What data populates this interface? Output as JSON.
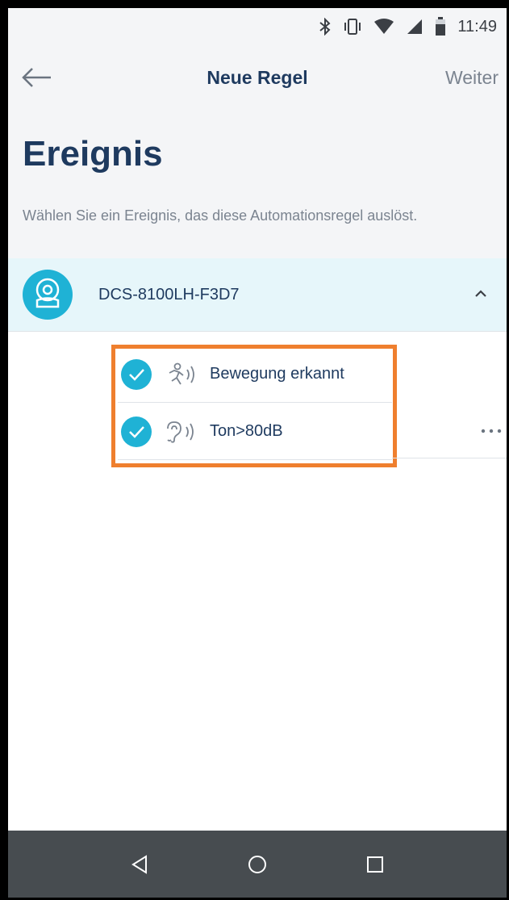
{
  "status_bar": {
    "time": "11:49",
    "icons": [
      "bluetooth-icon",
      "vibrate-icon",
      "wifi-icon",
      "cell-signal-icon",
      "battery-icon"
    ]
  },
  "app_bar": {
    "back_icon": "arrow-left-icon",
    "title": "Neue Regel",
    "next_label": "Weiter"
  },
  "header": {
    "title": "Ereignis",
    "description": "Wählen Sie ein Ereignis, das diese Automationsregel auslöst."
  },
  "device": {
    "name": "DCS-8100LH-F3D7",
    "icon": "camera-icon",
    "expand_icon": "chevron-up-icon"
  },
  "events": [
    {
      "label": "Bewegung erkannt",
      "icon": "motion-sound-icon",
      "checked": true
    },
    {
      "label": "Ton>80dB",
      "icon": "ear-sound-icon",
      "checked": true
    }
  ],
  "more_icon": "more-horizontal-icon",
  "nav": {
    "icons": [
      "back-triangle-icon",
      "home-circle-icon",
      "recents-square-icon"
    ]
  },
  "colors": {
    "accent": "#1fb2d5",
    "highlight": "#ef7f2e",
    "title_text": "#1e3a5f",
    "muted_text": "#7b8490",
    "device_row_bg": "#e6f6fa",
    "nav_bg": "#474c50"
  }
}
